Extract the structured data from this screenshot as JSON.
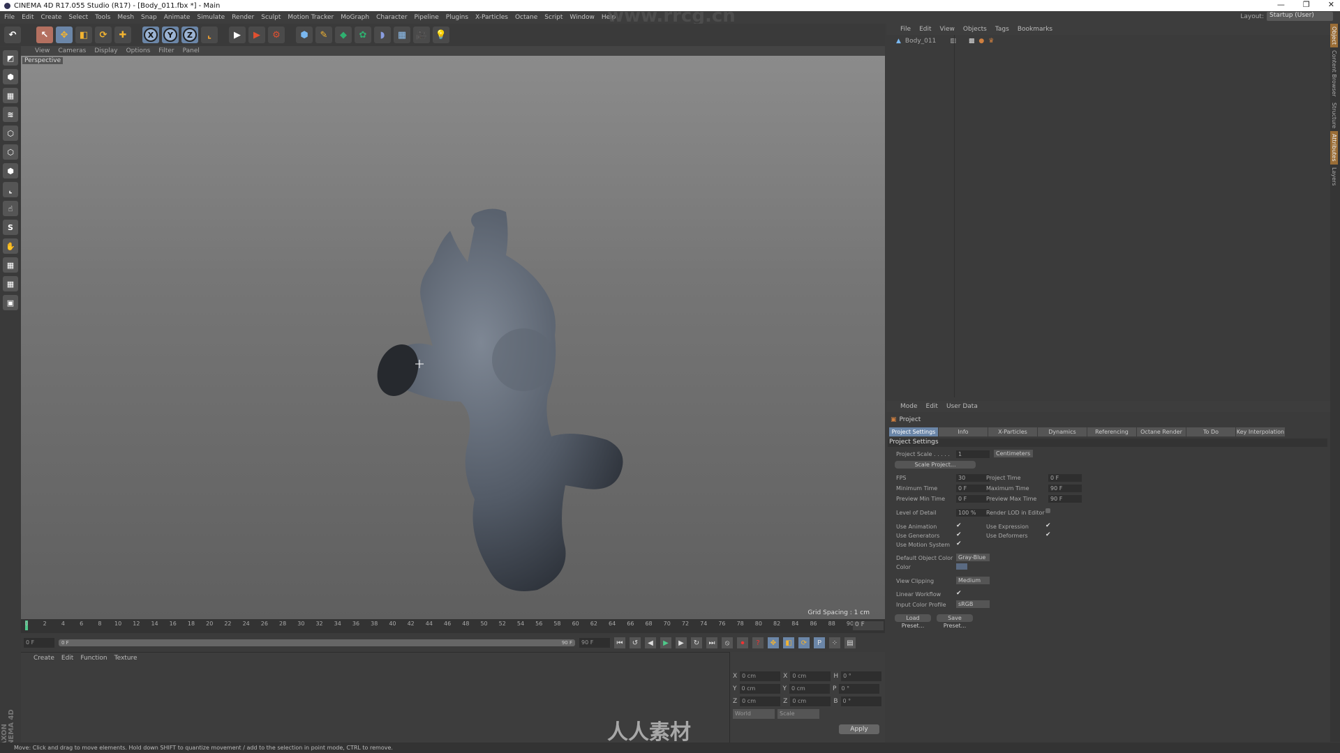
{
  "window": {
    "title": "CINEMA 4D R17.055 Studio (R17) - [Body_011.fbx *] - Main",
    "minimize": "—",
    "maximize": "❐",
    "close": "✕"
  },
  "menu": [
    "File",
    "Edit",
    "Create",
    "Select",
    "Tools",
    "Mesh",
    "Snap",
    "Animate",
    "Simulate",
    "Render",
    "Sculpt",
    "Motion Tracker",
    "MoGraph",
    "Character",
    "Pipeline",
    "Plugins",
    "X-Particles",
    "Octane",
    "Script",
    "Window",
    "Help"
  ],
  "layout": {
    "label": "Layout:",
    "value": "Startup (User)"
  },
  "watermark": "www.rrcg.cn",
  "watermark_bottom": "人人素材",
  "toolbar": {
    "undo": "↶",
    "select": "↖",
    "move": "✥",
    "scale": "◧",
    "rotate": "⟳",
    "live": "✚",
    "x": "X",
    "y": "Y",
    "z": "Z",
    "coord": "⌞",
    "render_view": "▶",
    "render_pv": "▶",
    "render_settings": "⚙",
    "cube": "⬢",
    "pen": "✎",
    "subdiv": "◆",
    "array": "✿",
    "deformer": "◗",
    "floor": "▦",
    "camera": "🎥",
    "light": "💡"
  },
  "viewport": {
    "menu": [
      "View",
      "Cameras",
      "Display",
      "Options",
      "Filter",
      "Panel"
    ],
    "camera": "Perspective",
    "grid_spacing": "Grid Spacing : 1 cm"
  },
  "timeline": {
    "ticks": [
      0,
      2,
      4,
      6,
      8,
      10,
      12,
      14,
      16,
      18,
      20,
      22,
      24,
      26,
      28,
      30,
      32,
      34,
      36,
      38,
      40,
      42,
      44,
      46,
      48,
      50,
      52,
      54,
      56,
      58,
      60,
      62,
      64,
      66,
      68,
      70,
      72,
      74,
      76,
      78,
      80,
      82,
      84,
      86,
      88,
      90
    ],
    "current": "0 F",
    "start": "0 F",
    "range_start": "0 F",
    "range_end": "90 F",
    "end": "90 F"
  },
  "material": {
    "menu": [
      "Create",
      "Edit",
      "Function",
      "Texture"
    ]
  },
  "coords": {
    "rows": [
      [
        "X",
        "0 cm",
        "X",
        "0 cm",
        "H",
        "0 °"
      ],
      [
        "Y",
        "0 cm",
        "Y",
        "0 cm",
        "P",
        "0 °"
      ],
      [
        "Z",
        "0 cm",
        "Z",
        "0 cm",
        "B",
        "0 °"
      ]
    ],
    "mode": "World",
    "scale": "Scale",
    "apply": "Apply"
  },
  "status": "Move: Click and drag to move elements. Hold down SHIFT to quantize movement / add to the selection in point mode, CTRL to remove.",
  "brand": "MAXON CINEMA 4D",
  "objects": {
    "menu": [
      "File",
      "Edit",
      "View",
      "Objects",
      "Tags",
      "Bookmarks"
    ],
    "items": [
      {
        "name": "Body_011"
      }
    ]
  },
  "attributes": {
    "menu": [
      "Mode",
      "Edit",
      "User Data"
    ],
    "object": "Project",
    "tabs": [
      "Project Settings",
      "Info",
      "X-Particles",
      "Dynamics",
      "Referencing",
      "Octane Render",
      "To Do",
      "Key Interpolation"
    ],
    "section": "Project Settings",
    "project_scale": {
      "label": "Project Scale . . . . .",
      "value": "1",
      "unit": "Centimeters"
    },
    "scale_button": "Scale Project...",
    "fps": {
      "label": "FPS",
      "value": "30"
    },
    "project_time": {
      "label": "Project Time",
      "value": "0 F"
    },
    "min_time": {
      "label": "Minimum Time",
      "value": "0 F"
    },
    "max_time": {
      "label": "Maximum Time",
      "value": "90 F"
    },
    "prev_min": {
      "label": "Preview Min Time",
      "value": "0 F"
    },
    "prev_max": {
      "label": "Preview Max Time",
      "value": "90 F"
    },
    "lod": {
      "label": "Level of Detail",
      "value": "100 %"
    },
    "render_lod": {
      "label": "Render LOD in Editor",
      "checked": false
    },
    "use_animation": {
      "label": "Use Animation",
      "checked": true
    },
    "use_expression": {
      "label": "Use Expression",
      "checked": true
    },
    "use_generators": {
      "label": "Use Generators",
      "checked": true
    },
    "use_deformers": {
      "label": "Use Deformers",
      "checked": true
    },
    "use_motion": {
      "label": "Use Motion System",
      "checked": true
    },
    "default_color": {
      "label": "Default Object Color",
      "value": "Gray-Blue"
    },
    "color": {
      "label": "Color",
      "swatch": "#5a6a82"
    },
    "view_clipping": {
      "label": "View Clipping",
      "value": "Medium"
    },
    "linear_workflow": {
      "label": "Linear Workflow",
      "checked": true
    },
    "input_profile": {
      "label": "Input Color Profile",
      "value": "sRGB"
    },
    "load_preset": "Load Preset...",
    "save_preset": "Save Preset..."
  },
  "side_tabs": [
    "Object",
    "Content Browser",
    "Structure",
    "Attributes",
    "Layers"
  ],
  "check_mark": "✔"
}
